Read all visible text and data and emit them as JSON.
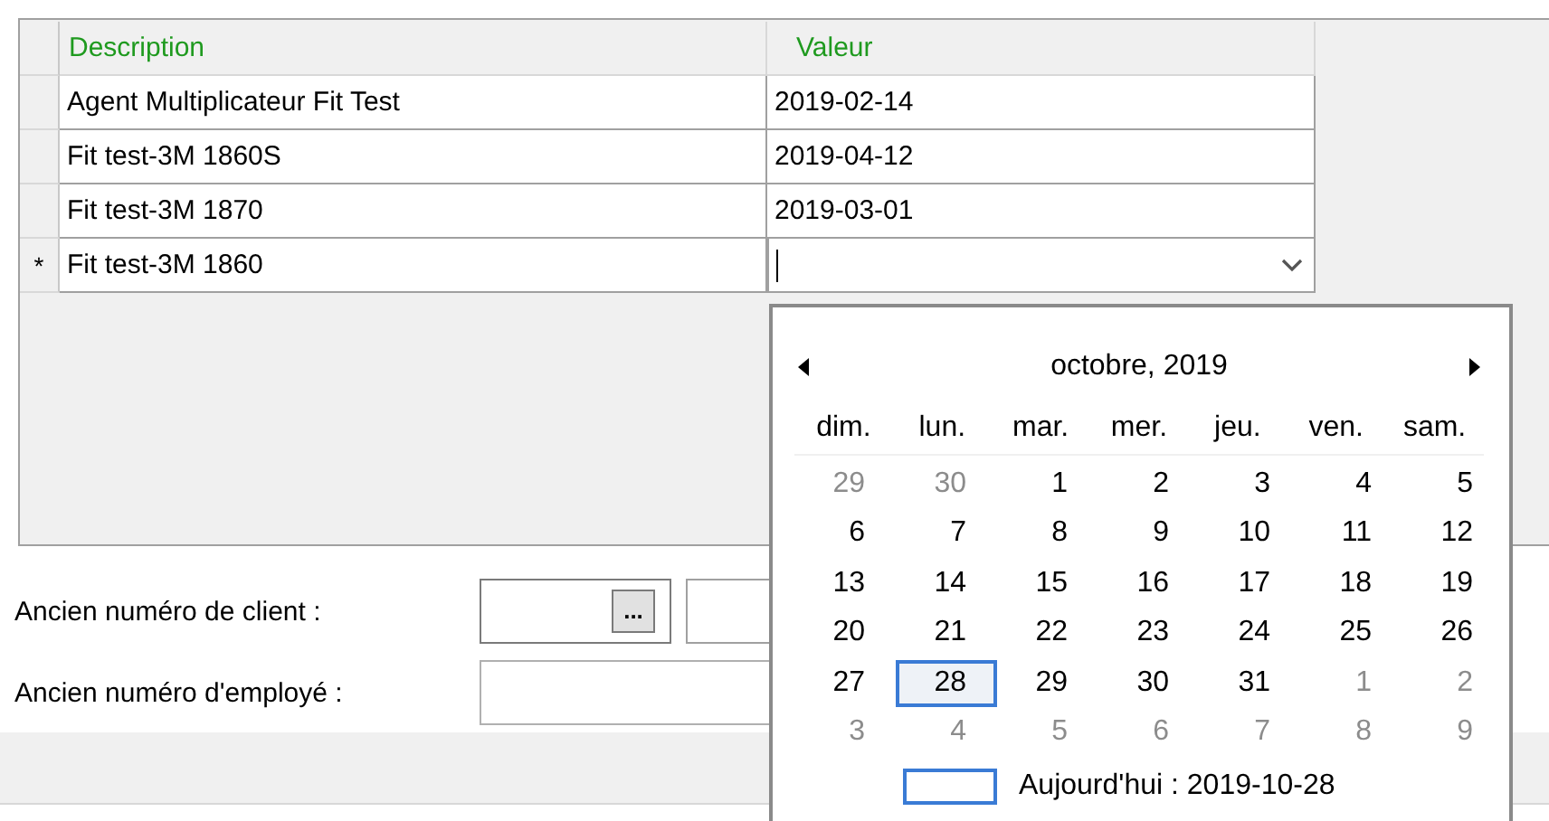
{
  "grid": {
    "columns": [
      "Description",
      "Valeur"
    ],
    "rows": [
      {
        "marker": "",
        "cells": [
          "Agent Multiplicateur Fit Test",
          "2019-02-14"
        ],
        "editing": false
      },
      {
        "marker": "",
        "cells": [
          "Fit test-3M 1860S",
          "2019-04-12"
        ],
        "editing": false
      },
      {
        "marker": "",
        "cells": [
          "Fit test-3M 1870",
          "2019-03-01"
        ],
        "editing": false
      },
      {
        "marker": "*",
        "cells": [
          "Fit test-3M 1860",
          ""
        ],
        "editing": true
      }
    ]
  },
  "form": {
    "fields": [
      {
        "label": "Ancien numéro de client :",
        "kind": "lookup",
        "ellipsis": "..."
      },
      {
        "label": "Ancien numéro d'employé :",
        "kind": "text"
      }
    ]
  },
  "calendar": {
    "title": "octobre, 2019",
    "weekdays": [
      "dim.",
      "lun.",
      "mar.",
      "mer.",
      "jeu.",
      "ven.",
      "sam."
    ],
    "weeks": [
      [
        {
          "day": "29",
          "muted": true,
          "selected": false
        },
        {
          "day": "30",
          "muted": true,
          "selected": false
        },
        {
          "day": "1",
          "muted": false,
          "selected": false
        },
        {
          "day": "2",
          "muted": false,
          "selected": false
        },
        {
          "day": "3",
          "muted": false,
          "selected": false
        },
        {
          "day": "4",
          "muted": false,
          "selected": false
        },
        {
          "day": "5",
          "muted": false,
          "selected": false
        }
      ],
      [
        {
          "day": "6",
          "muted": false,
          "selected": false
        },
        {
          "day": "7",
          "muted": false,
          "selected": false
        },
        {
          "day": "8",
          "muted": false,
          "selected": false
        },
        {
          "day": "9",
          "muted": false,
          "selected": false
        },
        {
          "day": "10",
          "muted": false,
          "selected": false
        },
        {
          "day": "11",
          "muted": false,
          "selected": false
        },
        {
          "day": "12",
          "muted": false,
          "selected": false
        }
      ],
      [
        {
          "day": "13",
          "muted": false,
          "selected": false
        },
        {
          "day": "14",
          "muted": false,
          "selected": false
        },
        {
          "day": "15",
          "muted": false,
          "selected": false
        },
        {
          "day": "16",
          "muted": false,
          "selected": false
        },
        {
          "day": "17",
          "muted": false,
          "selected": false
        },
        {
          "day": "18",
          "muted": false,
          "selected": false
        },
        {
          "day": "19",
          "muted": false,
          "selected": false
        }
      ],
      [
        {
          "day": "20",
          "muted": false,
          "selected": false
        },
        {
          "day": "21",
          "muted": false,
          "selected": false
        },
        {
          "day": "22",
          "muted": false,
          "selected": false
        },
        {
          "day": "23",
          "muted": false,
          "selected": false
        },
        {
          "day": "24",
          "muted": false,
          "selected": false
        },
        {
          "day": "25",
          "muted": false,
          "selected": false
        },
        {
          "day": "26",
          "muted": false,
          "selected": false
        }
      ],
      [
        {
          "day": "27",
          "muted": false,
          "selected": false
        },
        {
          "day": "28",
          "muted": false,
          "selected": true
        },
        {
          "day": "29",
          "muted": false,
          "selected": false
        },
        {
          "day": "30",
          "muted": false,
          "selected": false
        },
        {
          "day": "31",
          "muted": false,
          "selected": false
        },
        {
          "day": "1",
          "muted": true,
          "selected": false
        },
        {
          "day": "2",
          "muted": true,
          "selected": false
        }
      ],
      [
        {
          "day": "3",
          "muted": true,
          "selected": false
        },
        {
          "day": "4",
          "muted": true,
          "selected": false
        },
        {
          "day": "5",
          "muted": true,
          "selected": false
        },
        {
          "day": "6",
          "muted": true,
          "selected": false
        },
        {
          "day": "7",
          "muted": true,
          "selected": false
        },
        {
          "day": "8",
          "muted": true,
          "selected": false
        },
        {
          "day": "9",
          "muted": true,
          "selected": false
        }
      ]
    ],
    "today": "Aujourd'hui : 2019-10-28"
  }
}
